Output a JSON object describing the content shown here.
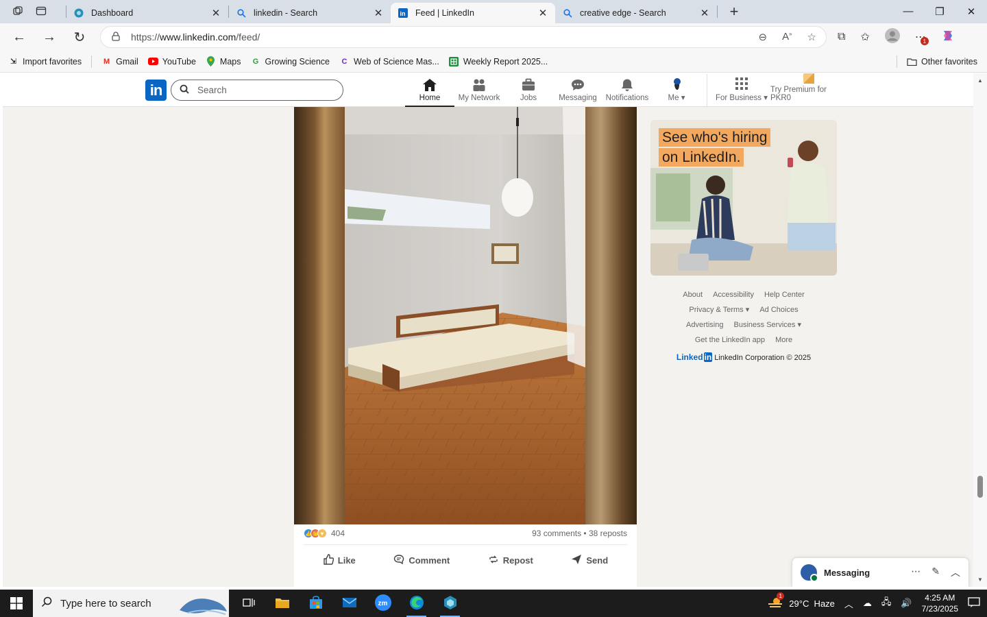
{
  "browser": {
    "tabs": [
      {
        "title": "Dashboard",
        "icon": "dashboard-favicon",
        "active": false
      },
      {
        "title": "linkedin - Search",
        "icon": "search-favicon",
        "active": false
      },
      {
        "title": "Feed | LinkedIn",
        "icon": "linkedin-favicon",
        "active": true
      },
      {
        "title": "creative edge - Search",
        "icon": "search-favicon",
        "active": false
      }
    ],
    "url_prefix": "https://",
    "url_host": "www.linkedin.com",
    "url_path": "/feed/",
    "favorites": [
      {
        "label": "Import favorites"
      },
      {
        "label": "Gmail"
      },
      {
        "label": "YouTube"
      },
      {
        "label": "Maps"
      },
      {
        "label": "Growing Science"
      },
      {
        "label": "Web of Science Mas..."
      },
      {
        "label": "Weekly Report 2025..."
      }
    ],
    "other_favorites": "Other favorites",
    "notification_count": "1"
  },
  "linkedin": {
    "logo_text": "in",
    "search_placeholder": "Search",
    "nav": [
      {
        "label": "Home",
        "icon": "home-icon",
        "active": true
      },
      {
        "label": "My Network",
        "icon": "network-icon",
        "active": false
      },
      {
        "label": "Jobs",
        "icon": "briefcase-icon",
        "active": false
      },
      {
        "label": "Messaging",
        "icon": "chat-icon",
        "active": false
      },
      {
        "label": "Notifications",
        "icon": "bell-icon",
        "active": false
      },
      {
        "label": "Me",
        "icon": "avatar-icon",
        "active": false
      },
      {
        "label": "For Business",
        "icon": "grid-icon",
        "active": false
      },
      {
        "label": "Try Premium for PKR0",
        "icon": "premium-icon",
        "active": false
      }
    ],
    "post": {
      "reaction_count": "404",
      "comments_reposts": "93 comments • 38 reposts",
      "actions": [
        "Like",
        "Comment",
        "Repost",
        "Send"
      ]
    },
    "ad": {
      "line1": "See who's hiring",
      "line2": "on LinkedIn."
    },
    "footer": {
      "row1": [
        "About",
        "Accessibility",
        "Help Center"
      ],
      "row2": [
        "Privacy & Terms ▾",
        "Ad Choices"
      ],
      "row3": [
        "Advertising",
        "Business Services ▾"
      ],
      "row4": [
        "Get the LinkedIn app",
        "More"
      ],
      "brand": "Linked",
      "brand_in": "in",
      "corp": "LinkedIn Corporation © 2025"
    },
    "messaging_widget": "Messaging"
  },
  "taskbar": {
    "search_placeholder": "Type here to search",
    "weather": "29°C  Haze",
    "weather_badge": "1",
    "time": "4:25 AM",
    "date": "7/23/2025"
  },
  "colors": {
    "linkedin_blue": "#0a66c2",
    "feed_bg": "#f4f2ee",
    "ad_orange": "#f3a85f"
  }
}
